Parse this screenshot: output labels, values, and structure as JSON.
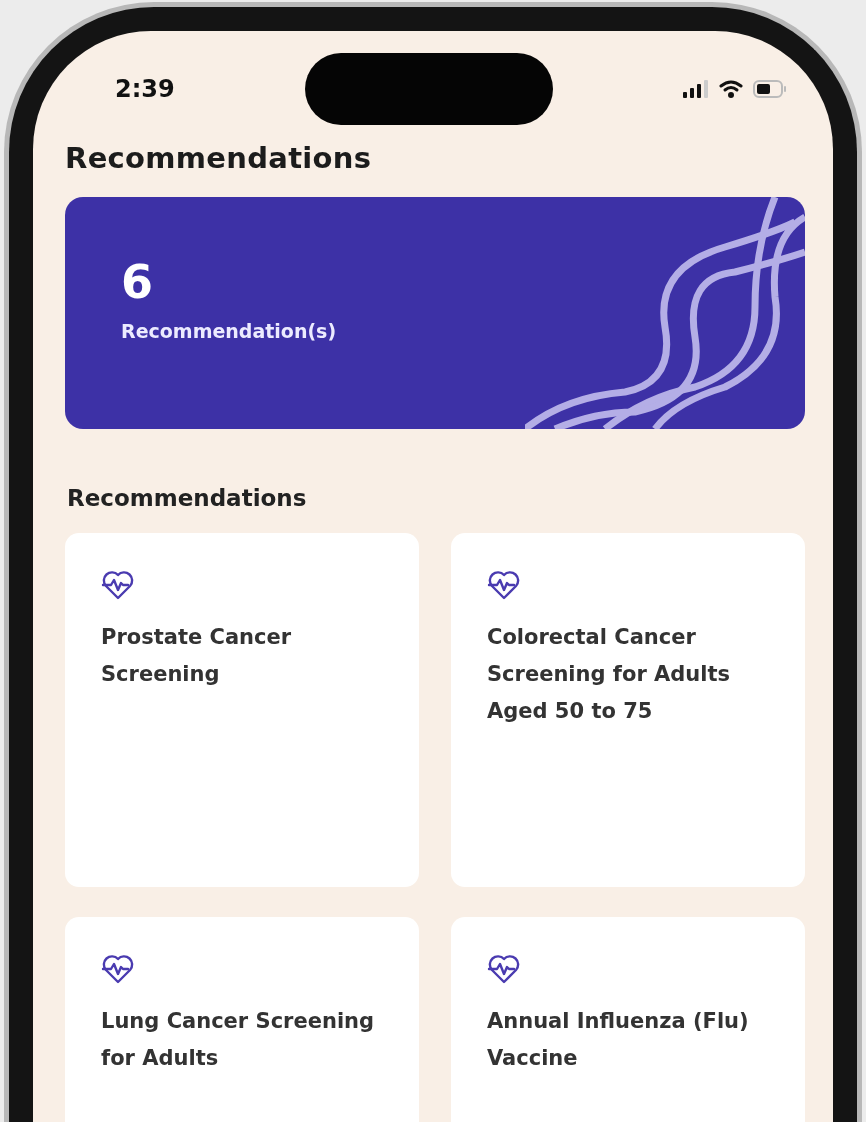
{
  "status_bar": {
    "time": "2:39"
  },
  "title": "Recommendations",
  "summary": {
    "count": "6",
    "label": "Recommendation(s)"
  },
  "section_title": "Recommendations",
  "recommendations": [
    {
      "title": "Prostate Cancer Screening"
    },
    {
      "title": "Colorectal Cancer Screening for Adults Aged 50 to 75"
    },
    {
      "title": "Lung Cancer Screening for Adults"
    },
    {
      "title": "Annual Influenza (Flu) Vaccine"
    }
  ]
}
